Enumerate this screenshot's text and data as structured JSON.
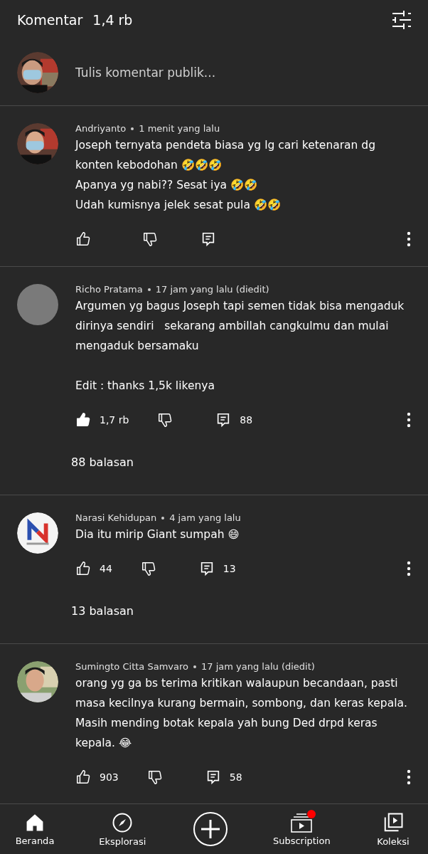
{
  "header": {
    "title": "Komentar",
    "count": "1,4 rb"
  },
  "compose": {
    "placeholder": "Tulis komentar publik...",
    "avatar": {
      "kind": "picture"
    }
  },
  "comments": [
    {
      "author": "Andriyanto",
      "time": "1 menit yang lalu",
      "avatar": {
        "kind": "picture"
      },
      "lines": [
        "Joseph ternyata pendeta biasa yg lg cari ketenaran dg konten kebodohan 🤣🤣🤣",
        "Apanya yg nabi?? Sesat iya 🤣🤣",
        "Udah kumisnya jelek sesat pula 🤣🤣"
      ],
      "liked": false
    },
    {
      "author": "Richo Pratama",
      "time": "17 jam yang lalu (diedit)",
      "avatar": {
        "kind": "blank"
      },
      "lines": [
        "Argumen yg bagus Joseph tapi semen tidak bisa mengaduk dirinya sendiri   sekarang ambillah cangkulmu dan mulai mengaduk bersamaku",
        {
          "text": "Edit : thanks 1,5k likenya",
          "new_paragraph": true
        }
      ],
      "liked": true,
      "likes": "1,7 rb",
      "replies": "88",
      "replies_link": "88 balasan"
    },
    {
      "author": "Narasi Kehidupan",
      "time": "4 jam yang lalu",
      "avatar": {
        "kind": "logo"
      },
      "lines": [
        "Dia itu mirip Giant sumpah 😄"
      ],
      "liked": false,
      "likes": "44",
      "replies": "13",
      "replies_link": "13 balasan"
    },
    {
      "author": "Sumingto Citta Samvaro",
      "time": "17 jam yang lalu (diedit)",
      "avatar": {
        "kind": "picture"
      },
      "lines": [
        "orang yg ga bs terima kritikan walaupun becandaan, pasti masa kecilnya kurang bermain, sombong, dan keras kepala. Masih mending botak kepala yah bung Ded drpd keras kepala. 😂"
      ],
      "liked": false,
      "likes": "903",
      "replies": "58"
    }
  ],
  "nav": [
    {
      "kind": "home",
      "label": "Beranda",
      "selected": true
    },
    {
      "kind": "explore",
      "label": "Eksplorasi",
      "selected": false
    },
    {
      "kind": "create",
      "selected": false
    },
    {
      "kind": "subscriptions",
      "label": "Subscription",
      "selected": false,
      "has_new": true
    },
    {
      "kind": "library",
      "label": "Koleksi",
      "selected": false
    }
  ]
}
